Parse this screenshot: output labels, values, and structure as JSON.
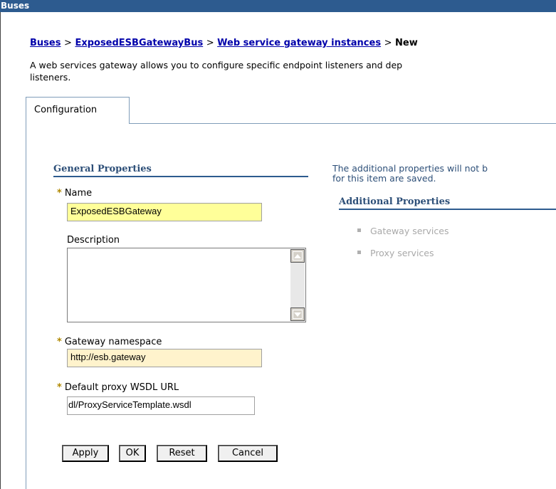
{
  "window": {
    "title": "Buses"
  },
  "breadcrumb": {
    "items": [
      "Buses",
      "ExposedESBGatewayBus",
      "Web service gateway instances"
    ],
    "current": "New",
    "separator": ">"
  },
  "description": "A web services gateway allows you to configure specific endpoint listeners and dep\nlisteners.",
  "tabs": [
    {
      "label": "Configuration"
    }
  ],
  "general": {
    "heading": "General Properties",
    "required_marker": "*",
    "name": {
      "label": "Name",
      "value": "ExposedESBGateway"
    },
    "description": {
      "label": "Description",
      "value": ""
    },
    "namespace": {
      "label": "Gateway namespace",
      "value": "http://esb.gateway"
    },
    "wsdl": {
      "label": "Default proxy WSDL URL",
      "value": "dl/ProxyServiceTemplate.wsdl"
    }
  },
  "buttons": {
    "apply": "Apply",
    "ok": "OK",
    "reset": "Reset",
    "cancel": "Cancel"
  },
  "additional": {
    "note": "The additional properties will not b\nfor this item are saved.",
    "heading": "Additional Properties",
    "items": [
      {
        "label": "Gateway services"
      },
      {
        "label": "Proxy services"
      }
    ]
  },
  "colors": {
    "title_bar": "#2d5b8f",
    "link": "#0000aa",
    "section_heading": "#2d4f78",
    "required_marker": "#b08800",
    "name_field": "#ffff99",
    "namespace_field": "#fff3cc"
  },
  "icons": {
    "scroll_up": "triangle-up-icon",
    "scroll_down": "triangle-down-icon",
    "list_bullet": "square-bullet-icon"
  }
}
